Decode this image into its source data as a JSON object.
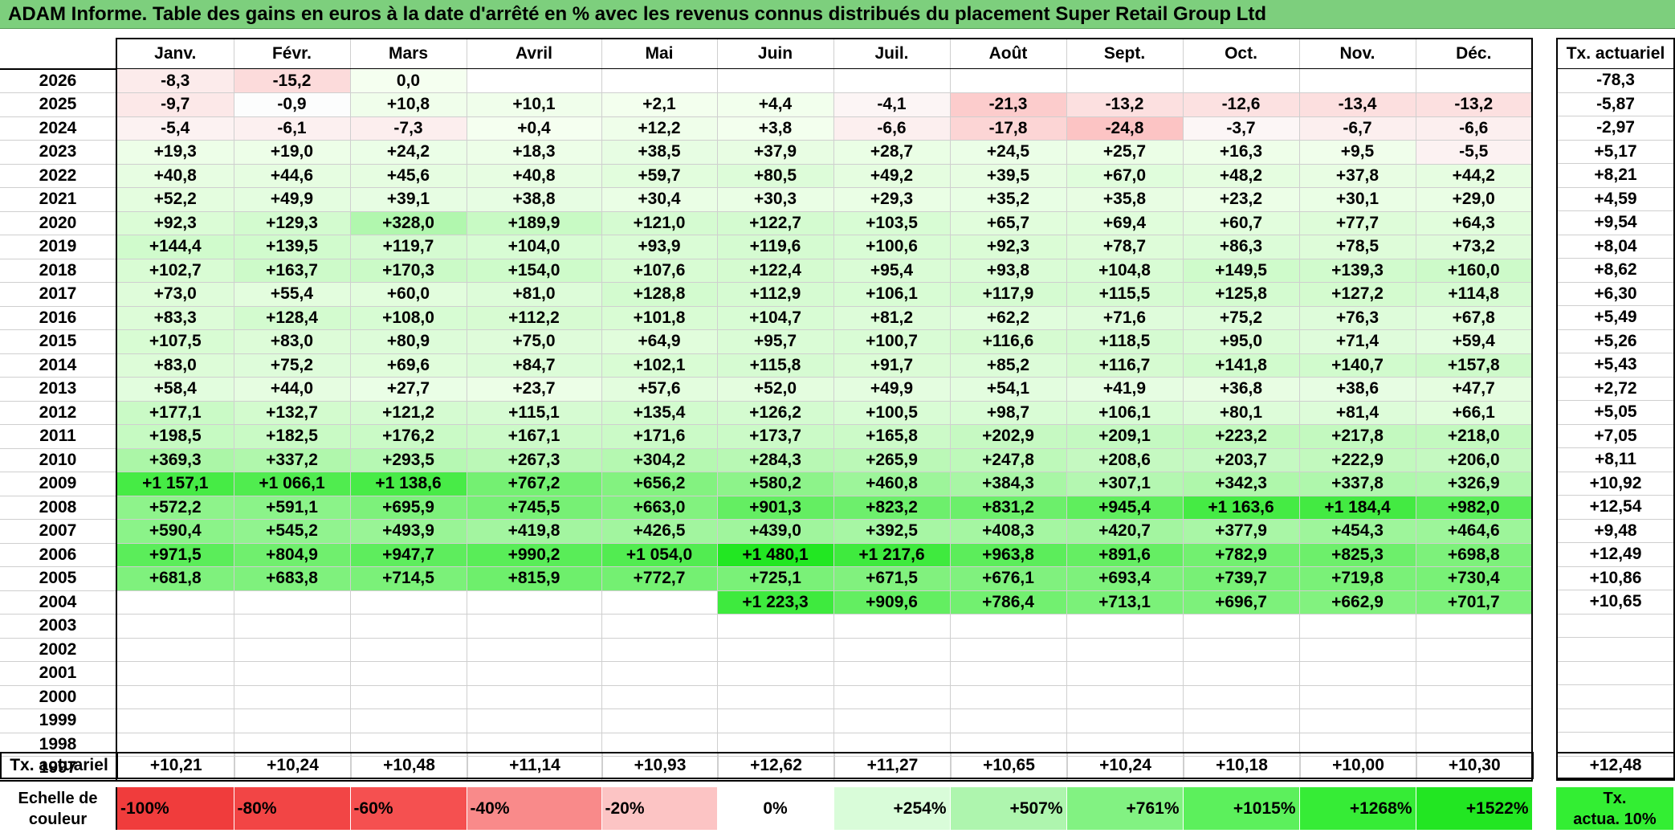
{
  "title": "ADAM Informe. Table des gains en euros à la date d'arrêté en % avec les revenus connus distribués du placement Super Retail Group Ltd",
  "months": [
    "Janv.",
    "Févr.",
    "Mars",
    "Avril",
    "Mai",
    "Juin",
    "Juil.",
    "Août",
    "Sept.",
    "Oct.",
    "Nov.",
    "Déc."
  ],
  "side_header": "Tx. actuariel",
  "rows": [
    {
      "year": "2026",
      "values": [
        "-8,3",
        "-15,2",
        "0,0",
        "",
        "",
        "",
        "",
        "",
        "",
        "",
        "",
        ""
      ],
      "rate": "-78,3"
    },
    {
      "year": "2025",
      "values": [
        "-9,7",
        "-0,9",
        "+10,8",
        "+10,1",
        "+2,1",
        "+4,4",
        "-4,1",
        "-21,3",
        "-13,2",
        "-12,6",
        "-13,4",
        "-13,2"
      ],
      "rate": "-5,87"
    },
    {
      "year": "2024",
      "values": [
        "-5,4",
        "-6,1",
        "-7,3",
        "+0,4",
        "+12,2",
        "+3,8",
        "-6,6",
        "-17,8",
        "-24,8",
        "-3,7",
        "-6,7",
        "-6,6"
      ],
      "rate": "-2,97"
    },
    {
      "year": "2023",
      "values": [
        "+19,3",
        "+19,0",
        "+24,2",
        "+18,3",
        "+38,5",
        "+37,9",
        "+28,7",
        "+24,5",
        "+25,7",
        "+16,3",
        "+9,5",
        "-5,5"
      ],
      "rate": "+5,17"
    },
    {
      "year": "2022",
      "values": [
        "+40,8",
        "+44,6",
        "+45,6",
        "+40,8",
        "+59,7",
        "+80,5",
        "+49,2",
        "+39,5",
        "+67,0",
        "+48,2",
        "+37,8",
        "+44,2"
      ],
      "rate": "+8,21"
    },
    {
      "year": "2021",
      "values": [
        "+52,2",
        "+49,9",
        "+39,1",
        "+38,8",
        "+30,4",
        "+30,3",
        "+29,3",
        "+35,2",
        "+35,8",
        "+23,2",
        "+30,1",
        "+29,0"
      ],
      "rate": "+4,59"
    },
    {
      "year": "2020",
      "values": [
        "+92,3",
        "+129,3",
        "+328,0",
        "+189,9",
        "+121,0",
        "+122,7",
        "+103,5",
        "+65,7",
        "+69,4",
        "+60,7",
        "+77,7",
        "+64,3"
      ],
      "rate": "+9,54"
    },
    {
      "year": "2019",
      "values": [
        "+144,4",
        "+139,5",
        "+119,7",
        "+104,0",
        "+93,9",
        "+119,6",
        "+100,6",
        "+92,3",
        "+78,7",
        "+86,3",
        "+78,5",
        "+73,2"
      ],
      "rate": "+8,04"
    },
    {
      "year": "2018",
      "values": [
        "+102,7",
        "+163,7",
        "+170,3",
        "+154,0",
        "+107,6",
        "+122,4",
        "+95,4",
        "+93,8",
        "+104,8",
        "+149,5",
        "+139,3",
        "+160,0"
      ],
      "rate": "+8,62"
    },
    {
      "year": "2017",
      "values": [
        "+73,0",
        "+55,4",
        "+60,0",
        "+81,0",
        "+128,8",
        "+112,9",
        "+106,1",
        "+117,9",
        "+115,5",
        "+125,8",
        "+127,2",
        "+114,8"
      ],
      "rate": "+6,30"
    },
    {
      "year": "2016",
      "values": [
        "+83,3",
        "+128,4",
        "+108,0",
        "+112,2",
        "+101,8",
        "+104,7",
        "+81,2",
        "+62,2",
        "+71,6",
        "+75,2",
        "+76,3",
        "+67,8"
      ],
      "rate": "+5,49"
    },
    {
      "year": "2015",
      "values": [
        "+107,5",
        "+83,0",
        "+80,9",
        "+75,0",
        "+64,9",
        "+95,7",
        "+100,7",
        "+116,6",
        "+118,5",
        "+95,0",
        "+71,4",
        "+59,4"
      ],
      "rate": "+5,26"
    },
    {
      "year": "2014",
      "values": [
        "+83,0",
        "+75,2",
        "+69,6",
        "+84,7",
        "+102,1",
        "+115,8",
        "+91,7",
        "+85,2",
        "+116,7",
        "+141,8",
        "+140,7",
        "+157,8"
      ],
      "rate": "+5,43"
    },
    {
      "year": "2013",
      "values": [
        "+58,4",
        "+44,0",
        "+27,7",
        "+23,7",
        "+57,6",
        "+52,0",
        "+49,9",
        "+54,1",
        "+41,9",
        "+36,8",
        "+38,6",
        "+47,7"
      ],
      "rate": "+2,72"
    },
    {
      "year": "2012",
      "values": [
        "+177,1",
        "+132,7",
        "+121,2",
        "+115,1",
        "+135,4",
        "+126,2",
        "+100,5",
        "+98,7",
        "+106,1",
        "+80,1",
        "+81,4",
        "+66,1"
      ],
      "rate": "+5,05"
    },
    {
      "year": "2011",
      "values": [
        "+198,5",
        "+182,5",
        "+176,2",
        "+167,1",
        "+171,6",
        "+173,7",
        "+165,8",
        "+202,9",
        "+209,1",
        "+223,2",
        "+217,8",
        "+218,0"
      ],
      "rate": "+7,05"
    },
    {
      "year": "2010",
      "values": [
        "+369,3",
        "+337,2",
        "+293,5",
        "+267,3",
        "+304,2",
        "+284,3",
        "+265,9",
        "+247,8",
        "+208,6",
        "+203,7",
        "+222,9",
        "+206,0"
      ],
      "rate": "+8,11"
    },
    {
      "year": "2009",
      "values": [
        "+1 157,1",
        "+1 066,1",
        "+1 138,6",
        "+767,2",
        "+656,2",
        "+580,2",
        "+460,8",
        "+384,3",
        "+307,1",
        "+342,3",
        "+337,8",
        "+326,9"
      ],
      "rate": "+10,92"
    },
    {
      "year": "2008",
      "values": [
        "+572,2",
        "+591,1",
        "+695,9",
        "+745,5",
        "+663,0",
        "+901,3",
        "+823,2",
        "+831,2",
        "+945,4",
        "+1 163,6",
        "+1 184,4",
        "+982,0"
      ],
      "rate": "+12,54"
    },
    {
      "year": "2007",
      "values": [
        "+590,4",
        "+545,2",
        "+493,9",
        "+419,8",
        "+426,5",
        "+439,0",
        "+392,5",
        "+408,3",
        "+420,7",
        "+377,9",
        "+454,3",
        "+464,6"
      ],
      "rate": "+9,48"
    },
    {
      "year": "2006",
      "values": [
        "+971,5",
        "+804,9",
        "+947,7",
        "+990,2",
        "+1 054,0",
        "+1 480,1",
        "+1 217,6",
        "+963,8",
        "+891,6",
        "+782,9",
        "+825,3",
        "+698,8"
      ],
      "rate": "+12,49"
    },
    {
      "year": "2005",
      "values": [
        "+681,8",
        "+683,8",
        "+714,5",
        "+815,9",
        "+772,7",
        "+725,1",
        "+671,5",
        "+676,1",
        "+693,4",
        "+739,7",
        "+719,8",
        "+730,4"
      ],
      "rate": "+10,86"
    },
    {
      "year": "2004",
      "values": [
        "",
        "",
        "",
        "",
        "",
        "+1 223,3",
        "+909,6",
        "+786,4",
        "+713,1",
        "+696,7",
        "+662,9",
        "+701,7"
      ],
      "rate": "+10,65"
    },
    {
      "year": "2003",
      "values": [
        "",
        "",
        "",
        "",
        "",
        "",
        "",
        "",
        "",
        "",
        "",
        ""
      ],
      "rate": ""
    },
    {
      "year": "2002",
      "values": [
        "",
        "",
        "",
        "",
        "",
        "",
        "",
        "",
        "",
        "",
        "",
        ""
      ],
      "rate": ""
    },
    {
      "year": "2001",
      "values": [
        "",
        "",
        "",
        "",
        "",
        "",
        "",
        "",
        "",
        "",
        "",
        ""
      ],
      "rate": ""
    },
    {
      "year": "2000",
      "values": [
        "",
        "",
        "",
        "",
        "",
        "",
        "",
        "",
        "",
        "",
        "",
        ""
      ],
      "rate": ""
    },
    {
      "year": "1999",
      "values": [
        "",
        "",
        "",
        "",
        "",
        "",
        "",
        "",
        "",
        "",
        "",
        ""
      ],
      "rate": ""
    },
    {
      "year": "1998",
      "values": [
        "",
        "",
        "",
        "",
        "",
        "",
        "",
        "",
        "",
        "",
        "",
        ""
      ],
      "rate": ""
    },
    {
      "year": "1997",
      "values": [
        "",
        "",
        "",
        "",
        "",
        "",
        "",
        "",
        "",
        "",
        "",
        ""
      ],
      "rate": ""
    }
  ],
  "summary": {
    "label": "Tx. actuariel",
    "values": [
      "+10,21",
      "+10,24",
      "+10,48",
      "+11,14",
      "+10,93",
      "+12,62",
      "+11,27",
      "+10,65",
      "+10,24",
      "+10,18",
      "+10,00",
      "+10,30"
    ],
    "overall": "+12,48"
  },
  "scale": {
    "label_line1": "Echelle de",
    "label_line2": "couleur",
    "cells": [
      {
        "text": "-100%",
        "color": "#f03c3c"
      },
      {
        "text": "-80%",
        "color": "#f24545"
      },
      {
        "text": "-60%",
        "color": "#f55050"
      },
      {
        "text": "-40%",
        "color": "#f98a8a"
      },
      {
        "text": "-20%",
        "color": "#fcc4c4"
      },
      {
        "text": "0%",
        "color": "#ffffff"
      },
      {
        "text": "+254%",
        "color": "#d9fcd9"
      },
      {
        "text": "+507%",
        "color": "#aef5ae"
      },
      {
        "text": "+761%",
        "color": "#82f282"
      },
      {
        "text": "+1015%",
        "color": "#5cf05c"
      },
      {
        "text": "+1268%",
        "color": "#36ec36"
      },
      {
        "text": "+1522%",
        "color": "#22e622"
      }
    ],
    "side_line1": "Tx.",
    "side_line2": "actua. 10%"
  }
}
